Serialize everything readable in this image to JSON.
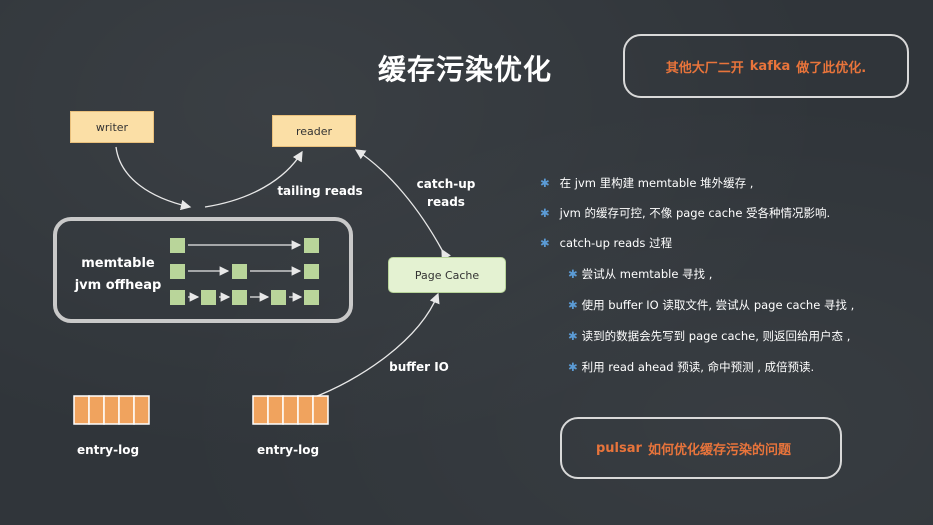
{
  "title": "缓存污染优化",
  "callout_top": {
    "prefix": "其他大厂二开 ",
    "highlight": "kafka",
    "suffix": " 做了此优化."
  },
  "callout_bottom": {
    "highlight": "pulsar",
    "suffix": " 如何优化缓存污染的问题"
  },
  "nodes": {
    "writer": "writer",
    "reader": "reader",
    "page_cache": "Page Cache",
    "memtable_line1": "memtable",
    "memtable_line2": "jvm offheap",
    "entry_log_left": "entry-log",
    "entry_log_right": "entry-log"
  },
  "edge_labels": {
    "tailing_reads": "tailing reads",
    "catch_up_line1": "catch-up",
    "catch_up_line2": "reads",
    "buffer_io": "buffer IO"
  },
  "bullets": [
    {
      "level": 1,
      "text": "在 jvm 里构建 memtable 堆外缓存 ,"
    },
    {
      "level": 1,
      "text": "jvm 的缓存可控, 不像 page cache 受各种情况影响."
    },
    {
      "level": 1,
      "text": "catch-up reads 过程"
    },
    {
      "level": 2,
      "text": "尝试从 memtable 寻找 ,"
    },
    {
      "level": 2,
      "text": "使用 buffer IO 读取文件, 尝试从 page cache 寻找 ,"
    },
    {
      "level": 2,
      "text": "读到的数据会先写到 page cache, 则返回给用户态 ,"
    },
    {
      "level": 2,
      "text": "利用 read ahead 预读, 命中预测 , 成倍预读."
    }
  ],
  "colors": {
    "background": "#30353a",
    "node_fill": "#fbdfa6",
    "page_cache_fill": "#e4f2d2",
    "memtable_cell": "#b9d59a",
    "entry_log_cell": "#f0a35e",
    "accent": "#e8743b",
    "bullet_star": "#5b9bd5"
  }
}
